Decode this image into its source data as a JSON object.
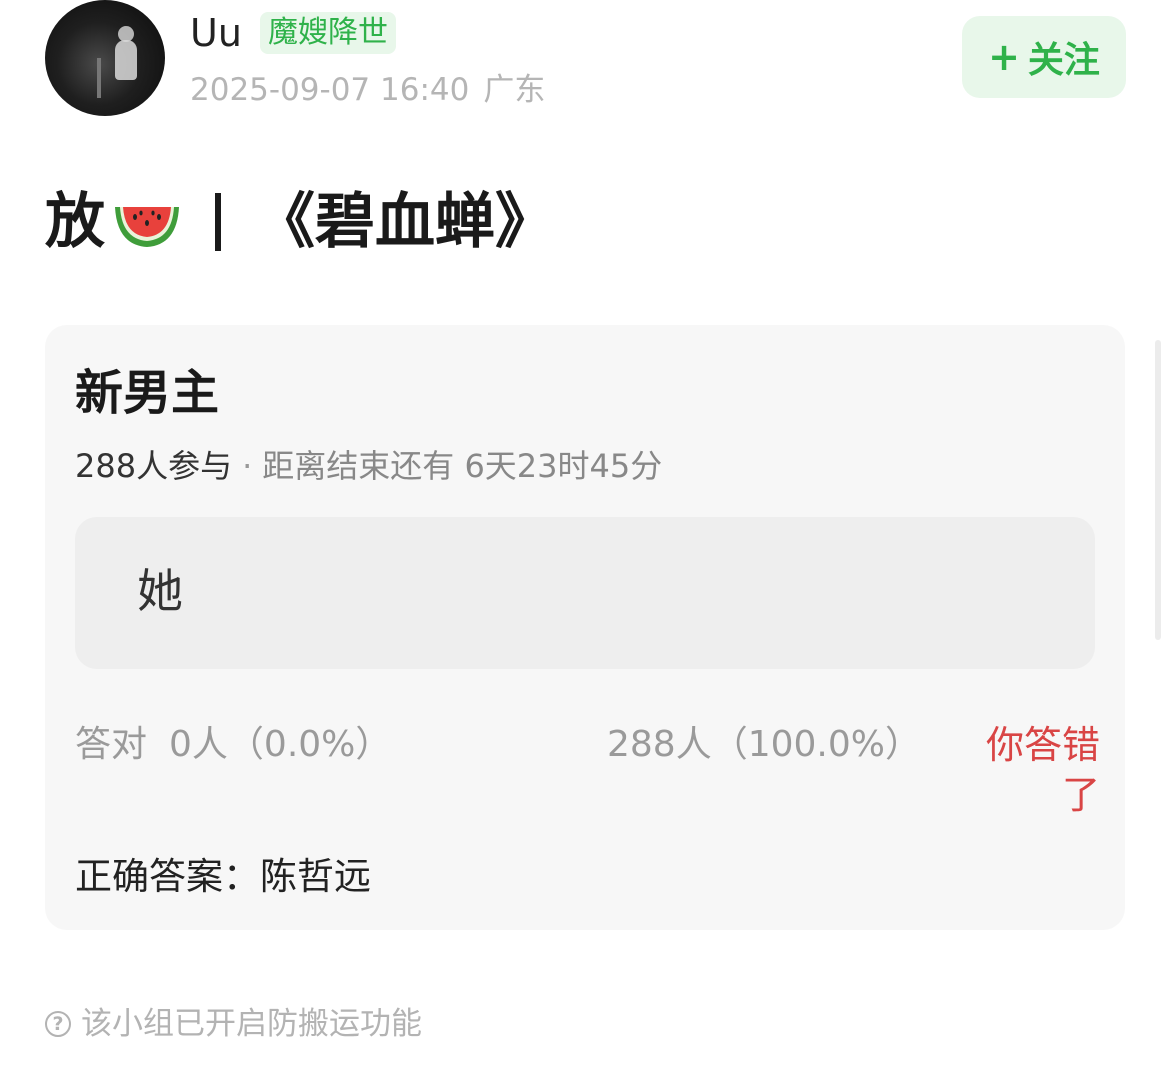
{
  "author": {
    "name": "Uu",
    "badge": "魔嫂降世",
    "datetime": "2025-09-07 16:40",
    "location": "广东"
  },
  "follow_button": {
    "plus": "+",
    "label": "关注"
  },
  "post": {
    "title_prefix": "放",
    "title_emoji": "watermelon-emoji",
    "title_main": "《碧血蝉》"
  },
  "quiz": {
    "question": "新男主",
    "participants": "288人参与",
    "separator": "·",
    "time_left": "距离结束还有 6天23时45分",
    "option": "她",
    "correct_label": "答对",
    "correct_count": "0人（0.0%）",
    "option_count": "288人（100.0%）",
    "result_status": "你答错了",
    "answer_text": "正确答案：陈哲远"
  },
  "footer": {
    "icon": "question-circle-icon",
    "note": "该小组已开启防搬运功能"
  },
  "colors": {
    "accent_green": "#2fb24a",
    "badge_bg": "#e8f7ea",
    "error_red": "#d94545",
    "card_bg": "#f7f7f7"
  }
}
